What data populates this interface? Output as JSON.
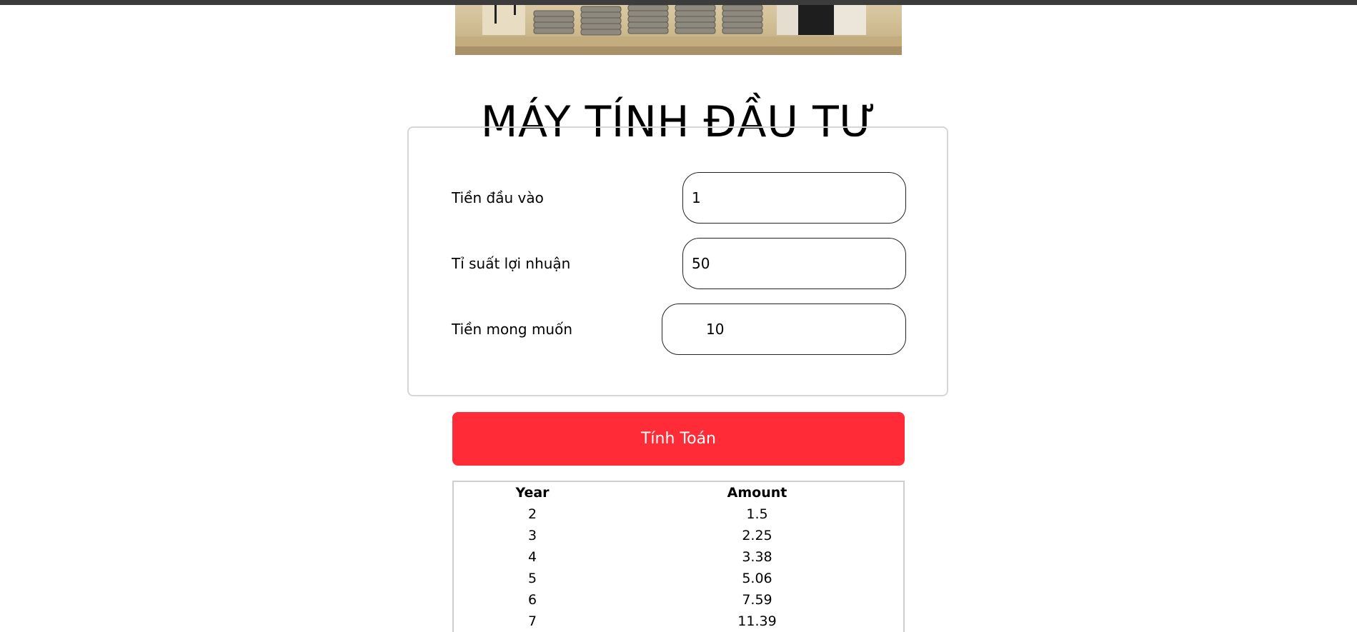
{
  "title": "MÁY TÍNH ĐẦU TƯ",
  "form": {
    "initial_label": "Tiền đầu vào",
    "initial_value": "1",
    "rate_label": "Tỉ suất lợi nhuận",
    "rate_value": "50",
    "target_label": "Tiền mong muốn",
    "target_value": "10"
  },
  "calculate_label": "Tính Toán",
  "table": {
    "headers": {
      "year": "Year",
      "amount": "Amount"
    },
    "rows": [
      {
        "year": "2",
        "amount": "1.5"
      },
      {
        "year": "3",
        "amount": "2.25"
      },
      {
        "year": "4",
        "amount": "3.38"
      },
      {
        "year": "5",
        "amount": "5.06"
      },
      {
        "year": "6",
        "amount": "7.59"
      },
      {
        "year": "7",
        "amount": "11.39"
      }
    ]
  },
  "colors": {
    "button": "#ff2b37",
    "card_border": "#d6d6d6",
    "topbar": "#3c3c3c"
  }
}
